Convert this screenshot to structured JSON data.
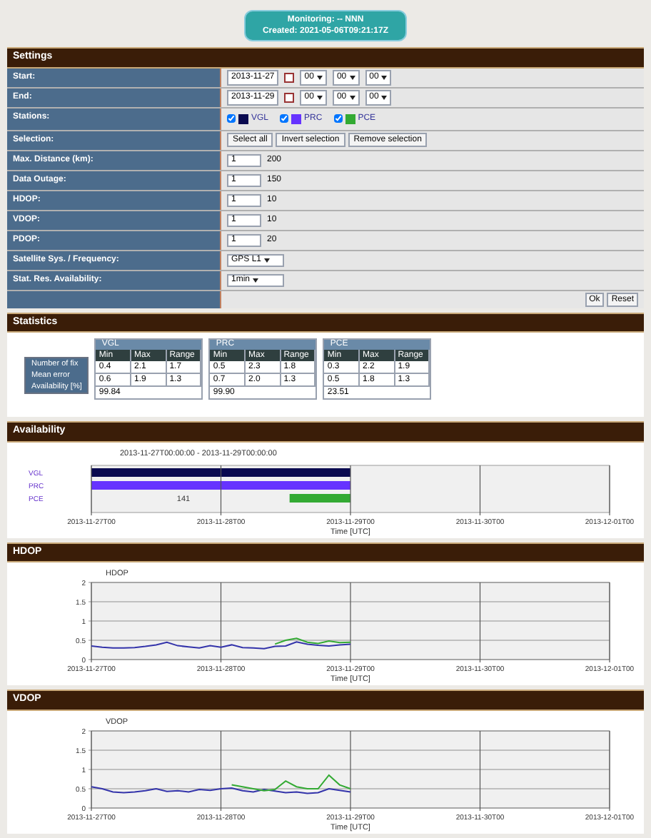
{
  "banner": {
    "line1": "Monitoring: -- NNN",
    "line2": "Created: 2021-05-06T09:21:17Z"
  },
  "settings": {
    "title": "Settings",
    "rows": [
      {
        "kind": "date",
        "label": "Start:",
        "value": "2013-11-27",
        "time": [
          "00",
          "00",
          "00"
        ]
      },
      {
        "kind": "date",
        "label": "End:",
        "value": "2013-11-29",
        "time": [
          "00",
          "00",
          "00"
        ]
      },
      {
        "kind": "stations",
        "label": "Stations:",
        "stations": [
          {
            "name": "VGL",
            "color": "#0a0a50",
            "checked": true
          },
          {
            "name": "PRC",
            "color": "#6633ff",
            "checked": true
          },
          {
            "name": "PCE",
            "color": "#33aa33",
            "checked": true
          }
        ]
      },
      {
        "kind": "buttons",
        "label": "Selection:",
        "buttons": [
          "Select all",
          "Invert selection",
          "Remove selection"
        ]
      },
      {
        "kind": "number",
        "label": "Max. Distance (km):",
        "value": "1",
        "unit": "200"
      },
      {
        "kind": "number",
        "label": "Data Outage:",
        "value": "1",
        "unit": "150"
      },
      {
        "kind": "number",
        "label": "HDOP:",
        "value": "1",
        "unit": "10"
      },
      {
        "kind": "number",
        "label": "VDOP:",
        "value": "1",
        "unit": "10"
      },
      {
        "kind": "number",
        "label": "PDOP:",
        "value": "1",
        "unit": "20"
      },
      {
        "kind": "select",
        "label": "Satellite Sys. / Frequency:",
        "value": "GPS L1"
      },
      {
        "kind": "select",
        "label": "Stat. Res. Availability:",
        "value": "1min"
      }
    ],
    "actions": [
      "Ok",
      "Reset"
    ]
  },
  "statistics": {
    "title": "Statistics",
    "legend": [
      "Number of fix",
      "Mean error",
      "Availability [%]"
    ],
    "stations": [
      {
        "name": "VGL",
        "columns": [
          "Min",
          "Max",
          "Range"
        ],
        "rows": [
          [
            "0.4",
            "2.1",
            "1.7"
          ],
          [
            "0.6",
            "1.9",
            "1.3"
          ]
        ],
        "availability": "99.84"
      },
      {
        "name": "PRC",
        "columns": [
          "Min",
          "Max",
          "Range"
        ],
        "rows": [
          [
            "0.5",
            "2.3",
            "1.8"
          ],
          [
            "0.7",
            "2.0",
            "1.3"
          ]
        ],
        "availability": "99.90"
      },
      {
        "name": "PCE",
        "columns": [
          "Min",
          "Max",
          "Range"
        ],
        "rows": [
          [
            "0.3",
            "2.2",
            "1.9"
          ],
          [
            "0.5",
            "1.8",
            "1.3"
          ]
        ],
        "availability": "23.51"
      }
    ]
  },
  "availability": {
    "title": "Availability",
    "timeline": {
      "title": "2013-11-27T00:00:00 - 2013-11-29T00:00:00",
      "xlabel": "Time [UTC]",
      "axis_labels": [
        "2013-11-27T00",
        "2013-11-28T00",
        "2013-11-29T00",
        "2013-11-30T00",
        "2013-12-01T00"
      ],
      "note": "141",
      "rows": [
        {
          "name": "VGL",
          "color": "#0a0a50",
          "kind": "full"
        },
        {
          "name": "PRC",
          "color": "#6633ff",
          "kind": "full"
        },
        {
          "name": "PCE",
          "color": "#33aa33",
          "kind": "partial"
        }
      ]
    }
  },
  "charts": [
    {
      "title": "HDOP",
      "chart_data": {
        "type": "line",
        "title": "HDOP",
        "xlabel": "Time [UTC]",
        "categories": [
          "2013-11-27T00",
          null,
          null,
          null,
          null,
          null,
          null,
          null,
          null,
          null,
          null,
          null,
          "2013-11-28T00",
          null,
          null,
          null,
          null,
          null,
          null,
          null,
          null,
          null,
          null,
          null,
          "2013-11-29T00",
          null,
          null,
          null,
          null,
          null,
          null,
          null,
          null,
          null,
          null,
          null,
          "2013-11-30T00",
          null,
          null,
          null,
          null,
          null,
          null,
          null,
          null,
          null,
          null,
          null,
          "2013-12-01T00"
        ],
        "series": [
          {
            "color": "#3333aa",
            "values": [
              0.35,
              0.32,
              0.3,
              0.3,
              0.31,
              0.34,
              0.38,
              0.45,
              0.36,
              0.33,
              0.3,
              0.36,
              0.32,
              0.38,
              0.31,
              0.3,
              0.28,
              0.34,
              0.35,
              0.46,
              0.4,
              0.37,
              0.35,
              0.38,
              0.4,
              null,
              null,
              null,
              null,
              null,
              null,
              null,
              null,
              null,
              null,
              null,
              null,
              null,
              null,
              null,
              null,
              null,
              null,
              null,
              null,
              null,
              null,
              null,
              null
            ]
          },
          {
            "color": "#33aa33",
            "values": [
              null,
              null,
              null,
              null,
              null,
              null,
              null,
              null,
              null,
              null,
              null,
              null,
              null,
              null,
              null,
              null,
              null,
              0.4,
              0.5,
              0.55,
              0.45,
              0.42,
              0.48,
              0.44,
              0.45,
              null,
              null,
              null,
              null,
              null,
              null,
              null,
              null,
              null,
              null,
              null,
              null,
              null,
              null,
              null,
              null,
              null,
              null,
              null,
              null,
              null,
              null,
              null,
              null
            ]
          }
        ],
        "ylim": [
          0,
          2
        ],
        "yticks": [
          0,
          0.5,
          1,
          1.5,
          2
        ],
        "grid": true
      }
    },
    {
      "title": "VDOP",
      "chart_data": {
        "type": "line",
        "title": "VDOP",
        "xlabel": "Time [UTC]",
        "categories": [
          "2013-11-27T00",
          null,
          null,
          null,
          null,
          null,
          null,
          null,
          null,
          null,
          null,
          null,
          "2013-11-28T00",
          null,
          null,
          null,
          null,
          null,
          null,
          null,
          null,
          null,
          null,
          null,
          "2013-11-29T00",
          null,
          null,
          null,
          null,
          null,
          null,
          null,
          null,
          null,
          null,
          null,
          "2013-11-30T00",
          null,
          null,
          null,
          null,
          null,
          null,
          null,
          null,
          null,
          null,
          null,
          "2013-12-01T00"
        ],
        "series": [
          {
            "color": "#3333aa",
            "values": [
              0.55,
              0.5,
              0.42,
              0.4,
              0.42,
              0.45,
              0.5,
              0.43,
              0.45,
              0.42,
              0.48,
              0.46,
              0.5,
              0.52,
              0.45,
              0.42,
              0.48,
              0.44,
              0.4,
              0.42,
              0.38,
              0.4,
              0.5,
              0.46,
              0.42,
              null,
              null,
              null,
              null,
              null,
              null,
              null,
              null,
              null,
              null,
              null,
              null,
              null,
              null,
              null,
              null,
              null,
              null,
              null,
              null,
              null,
              null,
              null,
              null
            ]
          },
          {
            "color": "#33aa33",
            "values": [
              null,
              null,
              null,
              null,
              null,
              null,
              null,
              null,
              null,
              null,
              null,
              null,
              null,
              0.6,
              0.55,
              0.5,
              0.45,
              0.48,
              0.7,
              0.55,
              0.5,
              0.5,
              0.85,
              0.6,
              0.5,
              null,
              null,
              null,
              null,
              null,
              null,
              null,
              null,
              null,
              null,
              null,
              null,
              null,
              null,
              null,
              null,
              null,
              null,
              null,
              null,
              null,
              null,
              null,
              null
            ]
          }
        ],
        "ylim": [
          0,
          2
        ],
        "yticks": [
          0,
          0.5,
          1,
          1.5,
          2
        ],
        "grid": true
      }
    }
  ]
}
